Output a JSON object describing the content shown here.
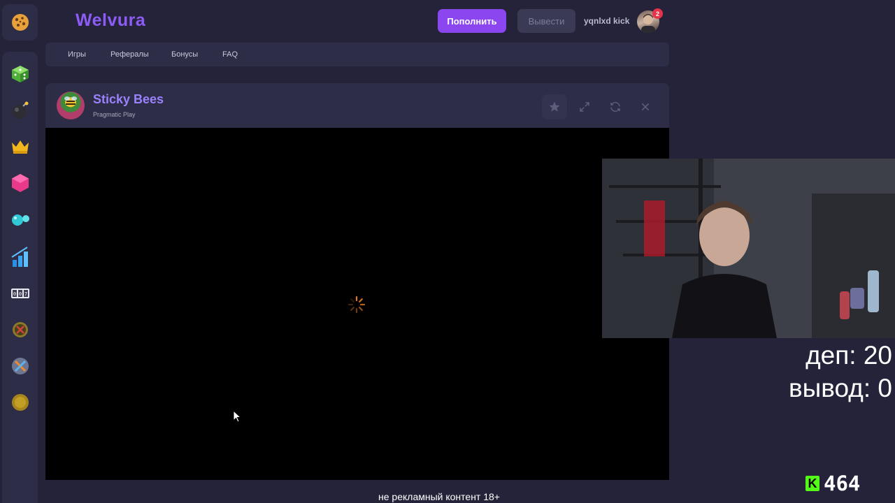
{
  "header": {
    "brand": "Welvura",
    "deposit_label": "Пополнить",
    "withdraw_label": "Вывести",
    "username": "yqnlxd kick",
    "notification_count": "2"
  },
  "sidebar": {
    "logo_icon": "cookie-icon",
    "items": [
      {
        "icon": "dice-icon"
      },
      {
        "icon": "bomb-icon"
      },
      {
        "icon": "crown-icon"
      },
      {
        "icon": "hexagon-icon"
      },
      {
        "icon": "balls-icon"
      },
      {
        "icon": "chart-icon"
      },
      {
        "icon": "counter-icon"
      },
      {
        "icon": "target-coin-icon"
      },
      {
        "icon": "crossed-coin-icon"
      },
      {
        "icon": "gold-coin-icon"
      }
    ]
  },
  "nav": {
    "links": [
      "Игры",
      "Рефералы",
      "Бонусы",
      "FAQ"
    ]
  },
  "game": {
    "title": "Sticky Bees",
    "provider": "Pragmatic Play",
    "controls": [
      "star-icon",
      "expand-icon",
      "refresh-icon",
      "close-icon"
    ]
  },
  "stream": {
    "deposit_text": "деп: 20",
    "withdraw_text": "вывод: 0",
    "viewer_count": "464",
    "disclaimer": "не рекламный контент 18+"
  },
  "colors": {
    "background": "#24233a",
    "panel": "#2e2d47",
    "accent": "#8b46f0",
    "brand": "#8d5cf6",
    "kick_green": "#53fc18"
  }
}
